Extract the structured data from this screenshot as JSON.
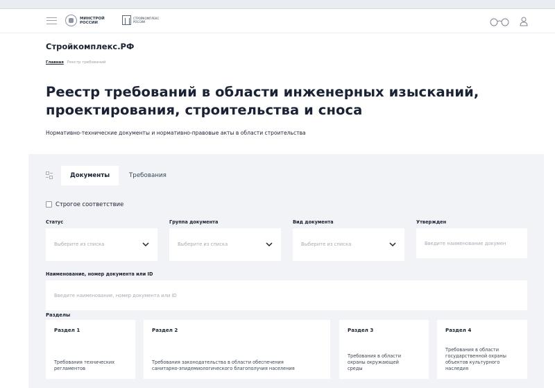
{
  "header": {
    "ministry_logo_text": "МИНСТРОЙ РОССИИ",
    "stroykompleks_logo_text": "СТРОЙКОМПЛЕКС РОССИИ",
    "icons": [
      "menu-icon",
      "accessibility-glasses-icon",
      "user-icon"
    ]
  },
  "site_title": "Стройкомплекс.РФ",
  "breadcrumb": {
    "home": "Главная",
    "current": "Реестр требований"
  },
  "page_title": "Реестр требований в области инженерных изысканий, проектирования, строительства и сноса",
  "subtitle": "Нормативно-технические документы и нормативно-правовые акты в области строительства",
  "tabs": [
    {
      "label": "Документы",
      "active": true
    },
    {
      "label": "Требования",
      "active": false
    }
  ],
  "strict_match": {
    "label": "Строгое соответствие",
    "checked": false
  },
  "filters": {
    "status": {
      "label": "Статус",
      "placeholder": "Выберите из списка"
    },
    "group": {
      "label": "Группа документа",
      "placeholder": "Выберите из списка"
    },
    "type": {
      "label": "Вид документа",
      "placeholder": "Выберите из списка"
    },
    "approved": {
      "label": "Утвержден",
      "placeholder": "Введите наименование докумен"
    },
    "name": {
      "label": "Наименование, номер документа или ID",
      "placeholder": "Введите наименование, номер документа или ID"
    }
  },
  "sections": {
    "label": "Разделы",
    "items": [
      {
        "title": "Раздел 1",
        "desc_lines": [
          "Требования технических",
          "регламентов"
        ]
      },
      {
        "title": "Раздел 2",
        "desc_lines": [
          "Требования законодательства в области обеспечения",
          "санитарно-эпидемиологического благополучия населения"
        ]
      },
      {
        "title": "Раздел 3",
        "desc_lines": [
          "Требования в области",
          "охраны окружающей",
          "среды"
        ]
      },
      {
        "title": "Раздел 4",
        "desc_lines": [
          "Требования в области",
          "государственной охраны",
          "объектов культурного",
          "наследия"
        ]
      }
    ]
  },
  "colors": {
    "panel_bg": "#f1f3f6",
    "text": "#1a2233",
    "placeholder": "#a4acb6",
    "topbar": "#e9edf1"
  }
}
